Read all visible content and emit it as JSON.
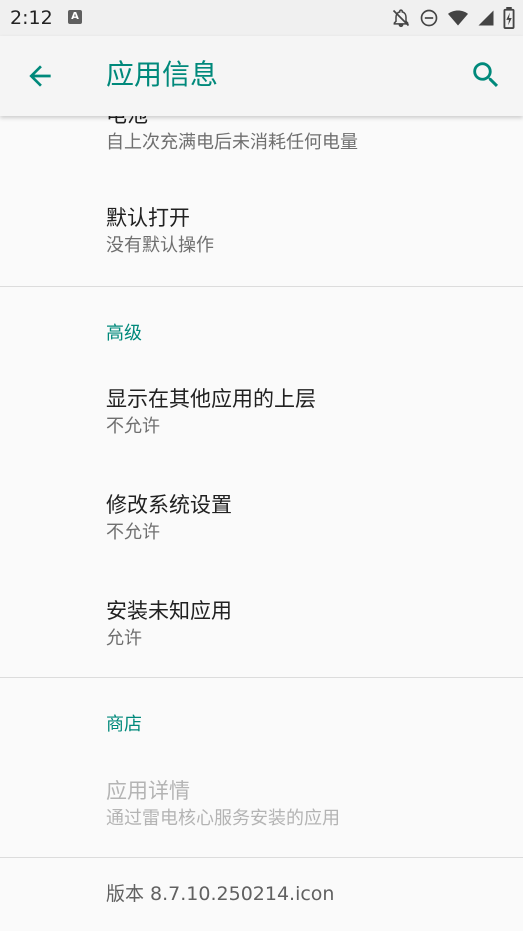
{
  "status_bar": {
    "time": "2:12",
    "notification_letter": "A"
  },
  "app_bar": {
    "title": "应用信息"
  },
  "sections": {
    "battery": {
      "title": "电池",
      "summary": "自上次充满电后未消耗任何电量"
    },
    "default_open": {
      "title": "默认打开",
      "summary": "没有默认操作"
    },
    "advanced": {
      "header": "高级",
      "items": [
        {
          "title": "显示在其他应用的上层",
          "summary": "不允许"
        },
        {
          "title": "修改系统设置",
          "summary": "不允许"
        },
        {
          "title": "安装未知应用",
          "summary": "允许"
        }
      ]
    },
    "store": {
      "header": "商店",
      "item": {
        "title": "应用详情",
        "summary": "通过雷电核心服务安装的应用"
      }
    },
    "version": "版本 8.7.10.250214.icon"
  },
  "colors": {
    "accent": "#00897b",
    "background": "#fafafa",
    "status_bar": "#f0f0f0"
  },
  "icons": {
    "back": "arrow-left-icon",
    "search": "search-icon",
    "status": [
      "notifications-off-icon",
      "do-not-disturb-icon",
      "wifi-icon",
      "cell-signal-icon",
      "battery-icon"
    ]
  }
}
